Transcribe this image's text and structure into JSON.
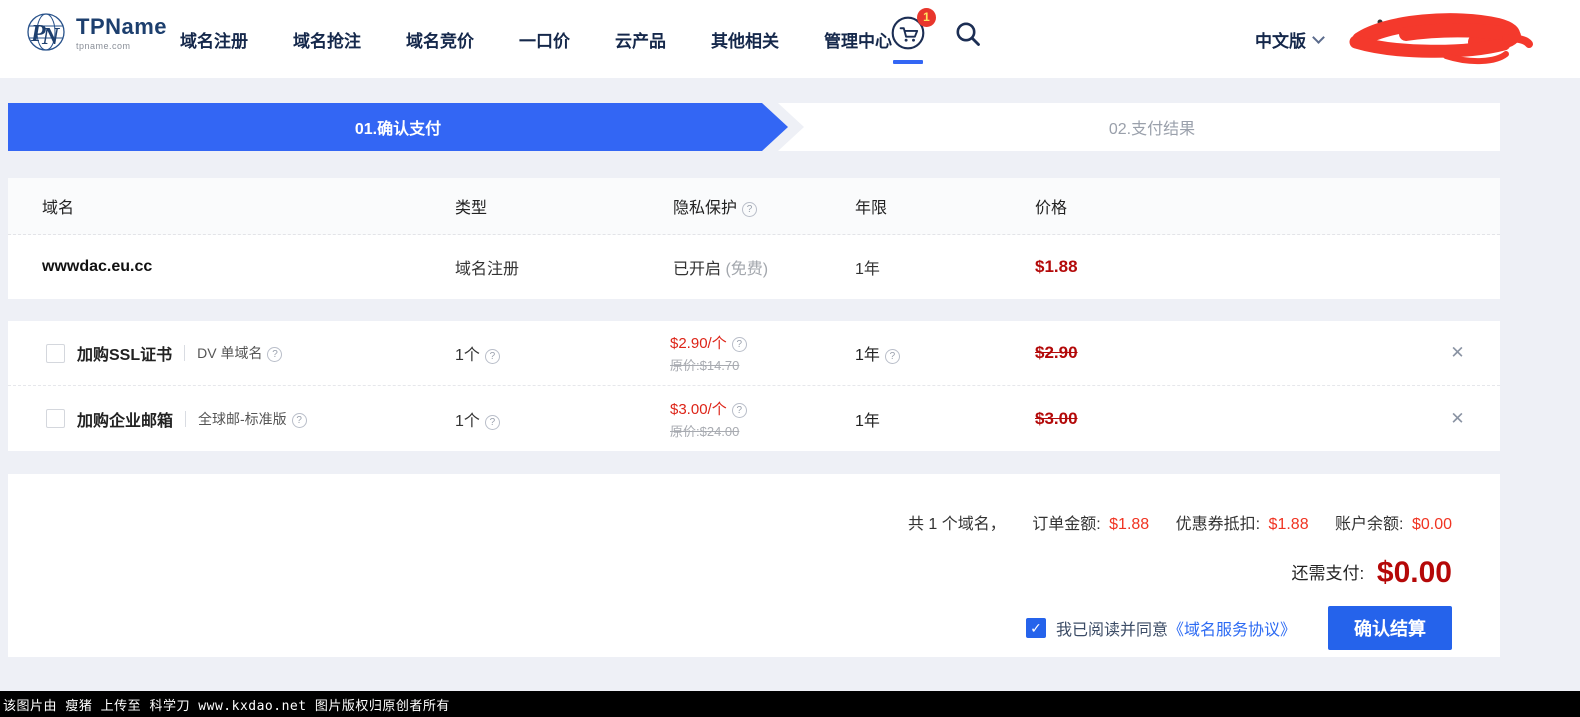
{
  "brand": {
    "name": "TPName",
    "domain": "tpname.com"
  },
  "nav": {
    "items": [
      "域名注册",
      "域名抢注",
      "域名竞价",
      "一口价",
      "云产品",
      "其他相关",
      "管理中心"
    ],
    "cart_badge": "1",
    "language": "中文版"
  },
  "steps": {
    "step1": "01.确认支付",
    "step2": "02.支付结果"
  },
  "order_table": {
    "headers": {
      "domain": "域名",
      "type": "类型",
      "privacy": "隐私保护",
      "years": "年限",
      "price": "价格"
    },
    "row": {
      "domain": "wwwdac.eu.cc",
      "type": "域名注册",
      "privacy": "已开启",
      "privacy_note": "(免费)",
      "years": "1年",
      "price": "$1.88"
    }
  },
  "addons": [
    {
      "title": "加购SSL证书",
      "subtitle": "DV 单域名",
      "qty": "1个",
      "unit_price": "$2.90/个",
      "original_price": "原价:$14.70",
      "years": "1年",
      "price": "$2.90"
    },
    {
      "title": "加购企业邮箱",
      "subtitle": "全球邮-标准版",
      "qty": "1个",
      "unit_price": "$3.00/个",
      "original_price": "原价:$24.00",
      "years": "1年",
      "price": "$3.00"
    }
  ],
  "summary": {
    "count_label": "共 1 个域名，",
    "order_amount_label": "订单金额:",
    "order_amount": "$1.88",
    "coupon_label": "优惠券抵扣:",
    "coupon": "$1.88",
    "balance_label": "账户余额:",
    "balance": "$0.00",
    "due_label": "还需支付:",
    "due": "$0.00",
    "agreement_prefix": "我已阅读并同意",
    "agreement_link": "《域名服务协议》",
    "checkout_button": "确认结算"
  },
  "icons": {
    "help": "?",
    "close": "✕",
    "check": "✓"
  },
  "colors": {
    "primary": "#3366f4",
    "price_dark_red": "#b30909",
    "bright_red": "#f03422",
    "badge_red": "#e8362c"
  },
  "watermark": "该图片由 瘦猪 上传至 科学刀 www.kxdao.net 图片版权归原创者所有"
}
